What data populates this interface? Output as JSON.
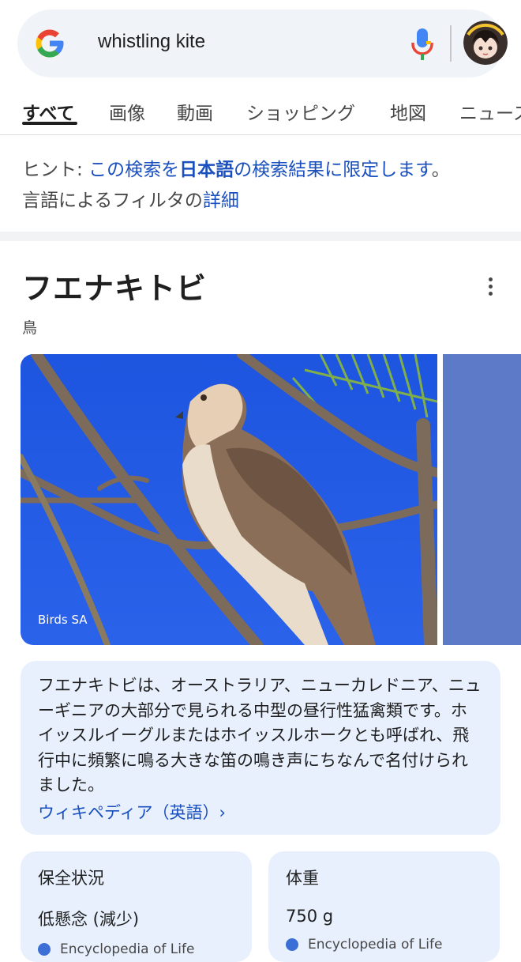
{
  "search": {
    "query": "whistling kite"
  },
  "tabs": [
    {
      "label": "すべて"
    },
    {
      "label": "画像"
    },
    {
      "label": "動画"
    },
    {
      "label": "ショッピング"
    },
    {
      "label": "地図"
    },
    {
      "label": "ニュース"
    }
  ],
  "hint": {
    "prefix": "ヒント: ",
    "link1": "この検索を",
    "bold": "日本語",
    "link2": "の検索結果に限定します",
    "period": "。",
    "line2_text": "言語によるフィルタの",
    "line2_link": "詳細"
  },
  "knowledge_panel": {
    "title": "フエナキトビ",
    "subtitle": "鳥",
    "photo_credit": "Birds SA",
    "description": "フエナキトビは、オーストラリア、ニューカレドニア、ニューギニアの大部分で見られる中型の昼行性猛禽類です。ホイッスルイーグルまたはホイッスルホークとも呼ばれ、飛行中に頻繁に鳴る大きな笛の鳴き声にちなんで名付けられました。",
    "description_link": "ウィキペディア（英語）›",
    "facts": [
      {
        "label": "保全状況",
        "value": "低懸念 (減少)",
        "source": "Encyclopedia of Life"
      },
      {
        "label": "体重",
        "value": "750 g",
        "source": "Encyclopedia of Life"
      }
    ]
  },
  "colors": {
    "link": "#1a4fbe",
    "card_bg": "#e8f0fe",
    "searchbar_bg": "#f0f4f9"
  }
}
